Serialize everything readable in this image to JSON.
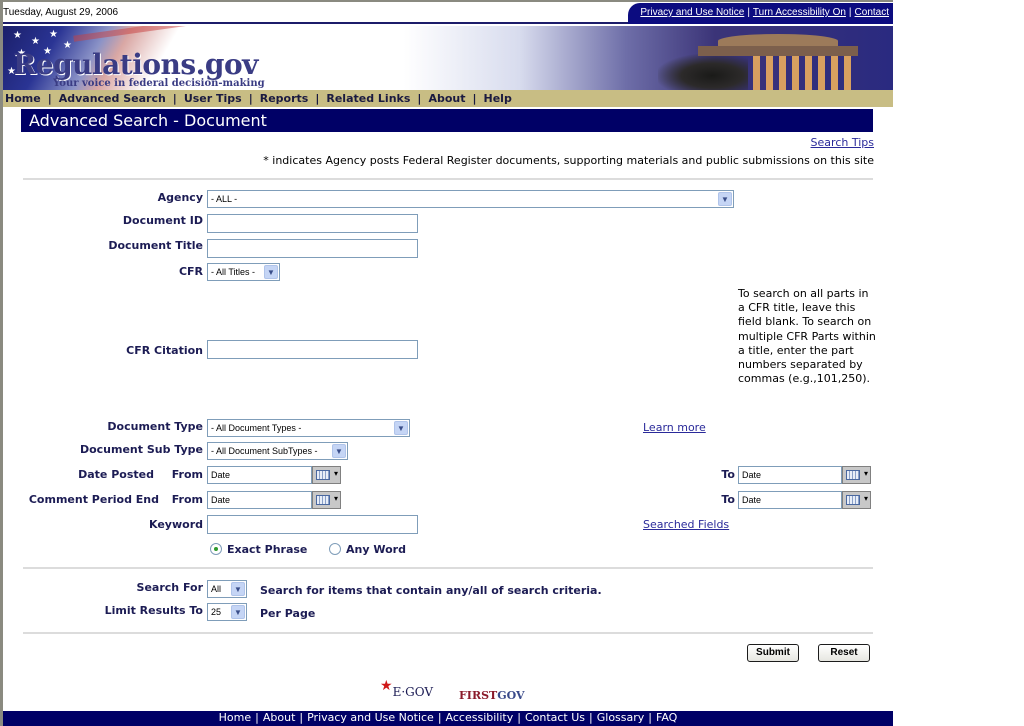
{
  "topbar": {
    "date": "Tuesday, August 29, 2006",
    "utility_links": [
      "Privacy and Use Notice",
      "Turn Accessibility On",
      "Contact"
    ]
  },
  "banner": {
    "logo": "Regulations.gov",
    "tagline": "Your voice in federal decision-making"
  },
  "nav": {
    "items": [
      "Home",
      "Advanced Search",
      "User Tips",
      "Reports",
      "Related Links",
      "About",
      "Help"
    ],
    "separator": "|"
  },
  "page": {
    "title": "Advanced Search - Document",
    "search_tips": "Search Tips",
    "note": "* indicates Agency posts Federal Register documents, supporting materials and public submissions on this site"
  },
  "form": {
    "agency": {
      "label": "Agency",
      "value": "- ALL -"
    },
    "document_id": {
      "label": "Document ID",
      "value": ""
    },
    "document_title": {
      "label": "Document Title",
      "value": ""
    },
    "cfr": {
      "label": "CFR",
      "value": "- All Titles -"
    },
    "cfr_citation": {
      "label": "CFR Citation",
      "value": "",
      "help": "To search on all parts in a CFR title, leave this field blank. To search on multiple CFR Parts within a title, enter the part numbers separated by commas (e.g.,101,250)."
    },
    "document_type": {
      "label": "Document Type",
      "value": "- All Document Types -",
      "learn_more": "Learn more"
    },
    "document_sub_type": {
      "label": "Document Sub Type",
      "value": "- All Document SubTypes -"
    },
    "date_posted": {
      "label": "Date Posted",
      "from_label": "From",
      "to_label": "To",
      "from_value": "Date",
      "to_value": "Date"
    },
    "comment_period_end": {
      "label": "Comment Period End",
      "from_label": "From",
      "to_label": "To",
      "from_value": "Date",
      "to_value": "Date"
    },
    "keyword": {
      "label": "Keyword",
      "value": "",
      "searched_fields": "Searched Fields"
    },
    "match_mode": {
      "options": [
        "Exact Phrase",
        "Any Word"
      ],
      "selected": "Exact Phrase"
    },
    "search_for": {
      "label": "Search For",
      "value": "All",
      "description": "Search for items that contain any/all of search criteria."
    },
    "limit_results": {
      "label": "Limit Results To",
      "value": "25",
      "suffix": "Per Page"
    },
    "submit_label": "Submit",
    "reset_label": "Reset"
  },
  "footer": {
    "logos": {
      "egov": "E·GOV",
      "firstgov_first": "FIRST",
      "firstgov_gov": "GOV"
    },
    "links": [
      "Home",
      "About",
      "Privacy and Use Notice",
      "Accessibility",
      "Contact Us",
      "Glossary",
      "FAQ"
    ]
  },
  "colors": {
    "header_navy": "#000066",
    "nav_tan": "#c8bd84",
    "label_navy": "#1c1c54",
    "link_blue": "#2a2a9a"
  }
}
